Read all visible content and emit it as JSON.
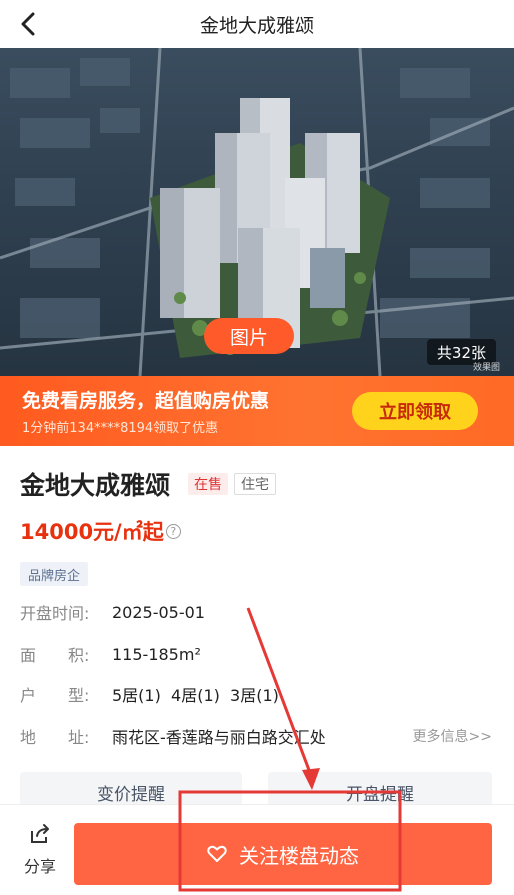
{
  "header": {
    "title": "金地大成雅颂",
    "back_icon": "back-arrow-icon"
  },
  "hero": {
    "photos_label": "图片",
    "photo_count": "共32张",
    "effect_note": "效果图"
  },
  "promo": {
    "title": "免费看房服务，超值购房优惠",
    "subtitle": "1分钟前134****8194领取了优惠",
    "button_label": "立即领取"
  },
  "property": {
    "name": "金地大成雅颂",
    "status_tag": "在售",
    "type_tag": "住宅",
    "price": "14000元/㎡起",
    "brand_badge": "品牌房企",
    "details": [
      {
        "label": "开盘时间:",
        "value": "2025-05-01"
      },
      {
        "label": "面　　积:",
        "value": "115-185m²"
      },
      {
        "label": "户　　型:",
        "value": "5居(1)  4居(1)  3居(1)"
      },
      {
        "label": "地　　址:",
        "value": "雨花区-香莲路与丽白路交汇处"
      }
    ],
    "more_info": "更多信息>>"
  },
  "actions": {
    "price_alert": "变价提醒",
    "open_alert": "开盘提醒"
  },
  "bottom": {
    "share_label": "分享",
    "follow_label": "关注楼盘动态"
  },
  "colors": {
    "accent": "#ff6542",
    "price": "#e8320f",
    "promo_bg": "#ff5a1f",
    "promo_button": "#ffd21c",
    "annotation": "#e53935"
  }
}
